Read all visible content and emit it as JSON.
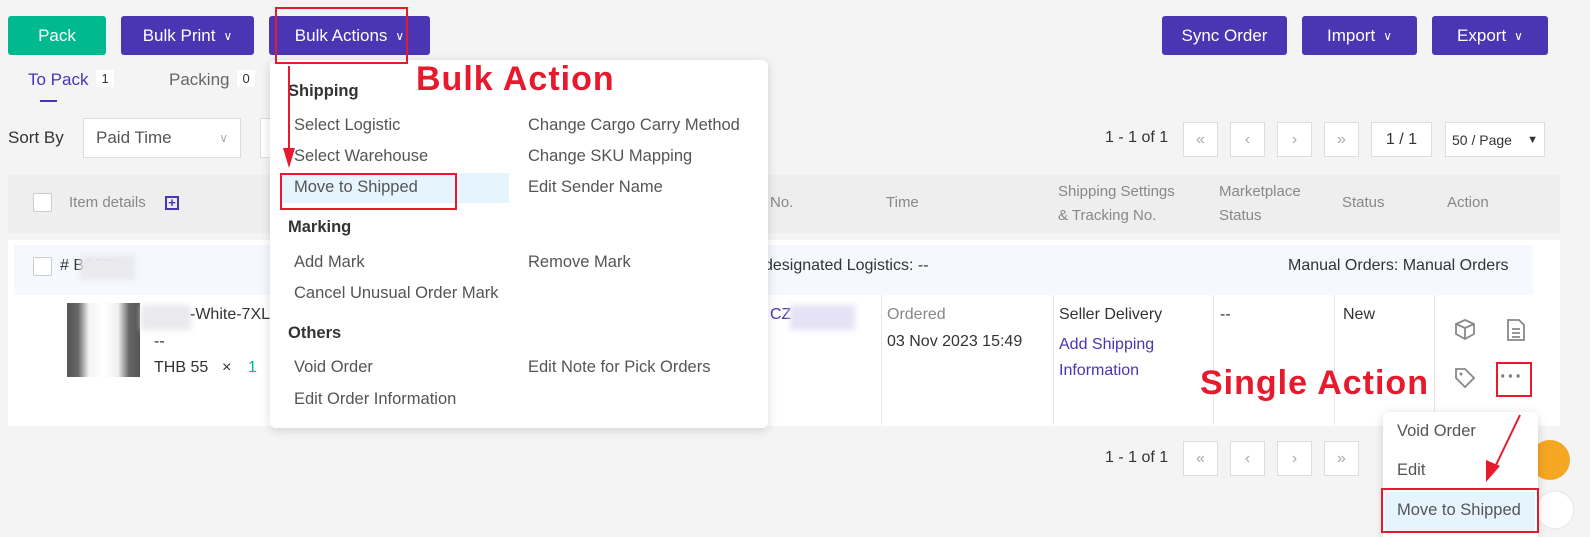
{
  "toolbar": {
    "pack": "Pack",
    "bulk_print": "Bulk Print",
    "bulk_actions": "Bulk Actions",
    "sync_order": "Sync Order",
    "import": "Import",
    "export": "Export",
    "chevron": "∨"
  },
  "tabs": [
    {
      "label": "To Pack",
      "count": "1",
      "active": true
    },
    {
      "label": "Packing",
      "count": "0"
    }
  ],
  "sort": {
    "label": "Sort By",
    "value": "Paid Time"
  },
  "pagination": {
    "range": "1 - 1 of 1",
    "page": "1 / 1",
    "per_page": "50 / Page",
    "first": "«",
    "prev": "‹",
    "next": "›",
    "last": "»"
  },
  "table": {
    "headers": {
      "item": "Item details",
      "no": "No.",
      "time": "Time",
      "shipping": [
        "Shipping Settings",
        "& Tracking No."
      ],
      "marketplace": [
        "Marketplace",
        "Status"
      ],
      "status": "Status",
      "action": "Action"
    }
  },
  "order": {
    "id": "# BS5S",
    "logistics": "designated Logistics: --",
    "source": "Manual Orders: Manual Orders",
    "product_name": "-White-7XL",
    "variant": "--",
    "price": "THB 55",
    "times": "×",
    "qty": "1",
    "order_no": "CZ",
    "time_label": "Ordered",
    "time_value": "03 Nov 2023 15:49",
    "shipping_method": "Seller Delivery",
    "add_shipping": "Add Shipping Information",
    "marketplace_status": "--",
    "status": "New"
  },
  "bulk_menu": {
    "sections": [
      {
        "title": "Shipping",
        "items": [
          "Select Logistic",
          "Change Cargo Carry Method",
          "Select Warehouse",
          "Change SKU Mapping",
          "Move to Shipped",
          "Edit Sender Name"
        ]
      },
      {
        "title": "Marking",
        "items": [
          "Add Mark",
          "Remove Mark",
          "Cancel Unusual Order Mark"
        ]
      },
      {
        "title": "Others",
        "items": [
          "Void Order",
          "Edit Note for Pick Orders",
          "Edit Order Information"
        ]
      }
    ]
  },
  "single_menu": {
    "items": [
      "Void Order",
      "Edit",
      "Move to Shipped"
    ]
  },
  "annotations": {
    "bulk": "Bulk Action",
    "single": "Single Action"
  },
  "colors": {
    "primary": "#4a35b3",
    "pack": "#00b98f",
    "annotation": "#e8192c",
    "link": "#4a35b3"
  }
}
